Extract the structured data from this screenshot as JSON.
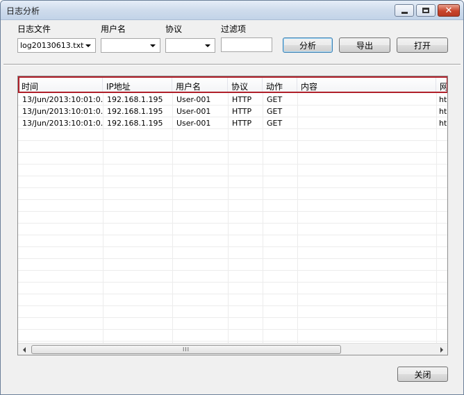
{
  "window": {
    "title": "日志分析"
  },
  "toolbar": {
    "logfile_label": "日志文件",
    "logfile_value": "log20130613.txt",
    "username_label": "用户名",
    "username_value": "",
    "protocol_label": "协议",
    "protocol_value": "",
    "filter_label": "过滤项",
    "filter_value": "",
    "analyze_label": "分析",
    "export_label": "导出",
    "open_label": "打开"
  },
  "table": {
    "columns": [
      "时间",
      "IP地址",
      "用户名",
      "协议",
      "动作",
      "内容",
      "网"
    ],
    "rows": [
      [
        "13/Jun/2013:10:01:0...",
        "192.168.1.195",
        "User-001",
        "HTTP",
        "GET",
        "",
        "ht"
      ],
      [
        "13/Jun/2013:10:01:0...",
        "192.168.1.195",
        "User-001",
        "HTTP",
        "GET",
        "",
        "ht"
      ],
      [
        "13/Jun/2013:10:01:0...",
        "192.168.1.195",
        "User-001",
        "HTTP",
        "GET",
        "",
        "ht"
      ]
    ],
    "scroll_grip": "III"
  },
  "footer": {
    "close_label": "关闭"
  },
  "colors": {
    "highlight": "#b0202a",
    "titlebar": "#cfdcec",
    "close_button": "#c8442c"
  }
}
